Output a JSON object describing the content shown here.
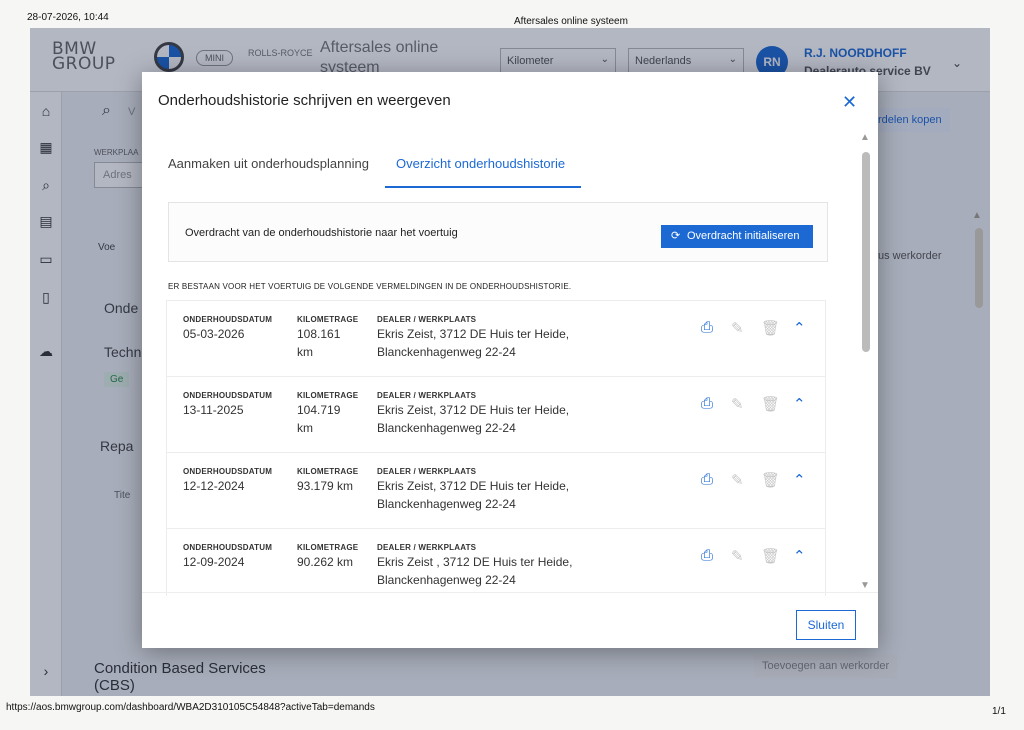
{
  "print": {
    "date": "28-07-2026, 10:44",
    "title": "Aftersales online systeem",
    "url": "https://aos.bmwgroup.com/dashboard/WBA2D310105C54848?activeTab=demands",
    "page": "1/1"
  },
  "app": {
    "brand_line1": "BMW",
    "brand_line2": "GROUP",
    "logo_mini": "MINI",
    "logo_rr": "ROLLS-ROYCE",
    "title_line1": "Aftersales online",
    "title_line2": "systeem",
    "unit_select": "Kilometer",
    "language_select": "Nederlands",
    "avatar_initials": "RN",
    "user_name": "R.J. NOORDHOFF",
    "user_org": "Dealerauto service BV",
    "bg_search_placeholder": "V",
    "bg_werkplaats": "WERKPLAA",
    "bg_adres": "Adres",
    "bg_voer": "Voe",
    "bg_onde": "Onde",
    "bg_techn": "Techn",
    "bg_ge": "Ge",
    "bg_repa": "Repa",
    "bg_tite": "Tite",
    "bg_onderdelen_btn": "rdelen kopen",
    "bg_werkorder": "us werkorder",
    "bg_cbs_line1": "Condition Based Services",
    "bg_cbs_line2": "(CBS)",
    "bg_toevoegen": "Toevoegen aan werkorder"
  },
  "modal": {
    "title": "Onderhoudshistorie schrijven en weergeven",
    "tabs": [
      {
        "label": "Aanmaken uit onderhoudsplanning",
        "active": false
      },
      {
        "label": "Overzicht onderhoudshistorie",
        "active": true
      }
    ],
    "transfer_label": "Overdracht van de onderhoudshistorie naar het voertuig",
    "transfer_button": "Overdracht initialiseren",
    "list_heading": "ER BESTAAN VOOR HET VOERTUIG DE VOLGENDE VERMELDINGEN IN DE ONDERHOUDSHISTORIE.",
    "col_date": "ONDERHOUDSDATUM",
    "col_km": "KILOMETRAGE",
    "col_dealer": "DEALER / WERKPLAATS",
    "entries": [
      {
        "date": "05-03-2026",
        "km": "108.161 km",
        "dealer_line1": "Ekris Zeist, 3712 DE Huis ter Heide,",
        "dealer_line2": "Blanckenhagenweg 22-24"
      },
      {
        "date": "13-11-2025",
        "km": "104.719 km",
        "dealer_line1": "Ekris Zeist, 3712 DE Huis ter Heide,",
        "dealer_line2": "Blanckenhagenweg 22-24"
      },
      {
        "date": "12-12-2024",
        "km": "93.179 km",
        "dealer_line1": "Ekris Zeist, 3712 DE Huis ter Heide,",
        "dealer_line2": "Blanckenhagenweg 22-24"
      },
      {
        "date": "12-09-2024",
        "km": "90.262 km",
        "dealer_line1": "Ekris Zeist , 3712 DE Huis ter Heide,",
        "dealer_line2": "Blanckenhagenweg 22-24"
      }
    ],
    "close_button": "Sluiten",
    "close_icon": "close-icon",
    "print_icon": "printer-icon",
    "edit_icon": "pencil-icon",
    "delete_icon": "trash-icon",
    "collapse_icon": "chevron-up-icon",
    "accent_color": "#1c69d4"
  }
}
